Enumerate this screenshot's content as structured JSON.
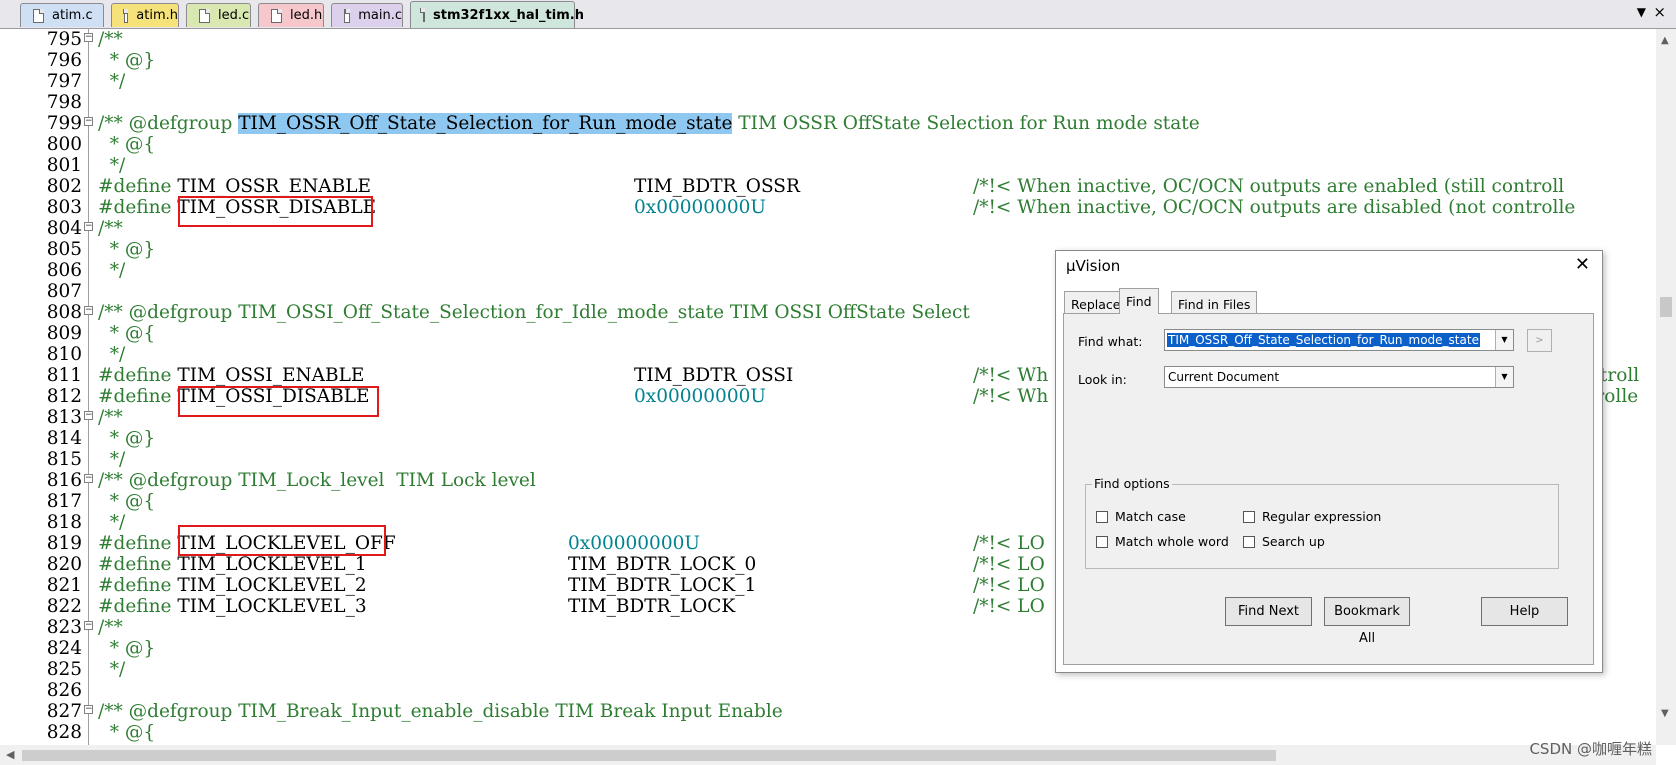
{
  "tabs": [
    {
      "label": "atim.c",
      "color": "#cfe0f5"
    },
    {
      "label": "atim.h",
      "color": "#f6e27a"
    },
    {
      "label": "led.c",
      "color": "#d8e8b0"
    },
    {
      "label": "led.h",
      "color": "#f6c8cc"
    },
    {
      "label": "main.c",
      "color": "#ddd0ec"
    },
    {
      "label": "stm32f1xx_hal_tim.h",
      "color": "#cfe6dc",
      "active": true
    }
  ],
  "tab_controls": {
    "menu": "▼",
    "close": "×"
  },
  "colors": {
    "keyword": "#2e7d32",
    "hex_literal": "#00838f",
    "selection": "#8ec8f0",
    "annotation_box": "#e0191b"
  },
  "code_lines": [
    {
      "num": "795",
      "fold": "⊟",
      "code": [
        [
          "g",
          "/**"
        ]
      ]
    },
    {
      "num": "796",
      "code": [
        [
          "g",
          "  * @}"
        ]
      ]
    },
    {
      "num": "797",
      "code": [
        [
          "g",
          "  */"
        ]
      ]
    },
    {
      "num": "798",
      "code": []
    },
    {
      "num": "799",
      "fold": "⊟",
      "code": [
        [
          "g",
          "/** @defgroup "
        ],
        [
          "sel",
          "TIM_OSSR_Off_State_Selection_for_Run_mode_state"
        ],
        [
          "g",
          " TIM OSSR OffState Selection for Run mode state"
        ]
      ]
    },
    {
      "num": "800",
      "code": [
        [
          "g",
          "  * @{"
        ]
      ]
    },
    {
      "num": "801",
      "code": [
        [
          "g",
          "  */"
        ]
      ]
    },
    {
      "num": "802",
      "code": [
        [
          "k",
          "#define "
        ],
        [
          "n",
          "TIM_OSSR_ENABLE"
        ]
      ],
      "col2": [
        [
          "n",
          "TIM_BDTR_OSSR"
        ]
      ],
      "col3": [
        [
          "g",
          "/*!< When inactive, OC/OCN outputs are enabled (still controll"
        ]
      ]
    },
    {
      "num": "803",
      "code": [
        [
          "k",
          "#define "
        ],
        [
          "n",
          "TIM_OSSR_DISABLE"
        ]
      ],
      "col2": [
        [
          "h",
          "0x00000000U"
        ]
      ],
      "col3": [
        [
          "g",
          "/*!< When inactive, OC/OCN outputs are disabled (not controlle"
        ]
      ]
    },
    {
      "num": "804",
      "fold": "⊟",
      "code": [
        [
          "g",
          "/**"
        ]
      ]
    },
    {
      "num": "805",
      "code": [
        [
          "g",
          "  * @}"
        ]
      ]
    },
    {
      "num": "806",
      "code": [
        [
          "g",
          "  */"
        ]
      ]
    },
    {
      "num": "807",
      "code": []
    },
    {
      "num": "808",
      "fold": "⊟",
      "code": [
        [
          "g",
          "/** @defgroup TIM_OSSI_Off_State_Selection_for_Idle_mode_state TIM OSSI OffState Select"
        ]
      ]
    },
    {
      "num": "809",
      "code": [
        [
          "g",
          "  * @{"
        ]
      ]
    },
    {
      "num": "810",
      "code": [
        [
          "g",
          "  */"
        ]
      ]
    },
    {
      "num": "811",
      "code": [
        [
          "k",
          "#define "
        ],
        [
          "n",
          "TIM_OSSI_ENABLE"
        ]
      ],
      "col2": [
        [
          "n",
          "TIM_BDTR_OSSI"
        ]
      ],
      "col3": [
        [
          "g",
          "/*!< Wh"
        ]
      ],
      "tail": "ntroll"
    },
    {
      "num": "812",
      "code": [
        [
          "k",
          "#define "
        ],
        [
          "n",
          "TIM_OSSI_DISABLE"
        ]
      ],
      "col2": [
        [
          "h",
          "0x00000000U"
        ]
      ],
      "col3": [
        [
          "g",
          "/*!< Wh"
        ]
      ],
      "tail": "trolle"
    },
    {
      "num": "813",
      "fold": "⊟",
      "code": [
        [
          "g",
          "/**"
        ]
      ]
    },
    {
      "num": "814",
      "code": [
        [
          "g",
          "  * @}"
        ]
      ]
    },
    {
      "num": "815",
      "code": [
        [
          "g",
          "  */"
        ]
      ]
    },
    {
      "num": "816",
      "fold": "⊟",
      "code": [
        [
          "g",
          "/** @defgroup TIM_Lock_level  TIM Lock level"
        ]
      ]
    },
    {
      "num": "817",
      "code": [
        [
          "g",
          "  * @{"
        ]
      ]
    },
    {
      "num": "818",
      "code": [
        [
          "g",
          "  */"
        ]
      ]
    },
    {
      "num": "819",
      "code": [
        [
          "k",
          "#define "
        ],
        [
          "n",
          "TIM_LOCKLEVEL_OFF"
        ]
      ],
      "col2b": [
        [
          "h",
          "0x00000000U"
        ]
      ],
      "col3": [
        [
          "g",
          "/*!< LO"
        ]
      ]
    },
    {
      "num": "820",
      "code": [
        [
          "k",
          "#define "
        ],
        [
          "n",
          "TIM_LOCKLEVEL_1"
        ]
      ],
      "col2b": [
        [
          "n",
          "TIM_BDTR_LOCK_0"
        ]
      ],
      "col3": [
        [
          "g",
          "/*!< LO"
        ]
      ]
    },
    {
      "num": "821",
      "code": [
        [
          "k",
          "#define "
        ],
        [
          "n",
          "TIM_LOCKLEVEL_2"
        ]
      ],
      "col2b": [
        [
          "n",
          "TIM_BDTR_LOCK_1"
        ]
      ],
      "col3": [
        [
          "g",
          "/*!< LO"
        ]
      ]
    },
    {
      "num": "822",
      "code": [
        [
          "k",
          "#define "
        ],
        [
          "n",
          "TIM_LOCKLEVEL_3"
        ]
      ],
      "col2b": [
        [
          "n",
          "TIM_BDTR_LOCK"
        ]
      ],
      "col3": [
        [
          "g",
          "/*!< LO"
        ]
      ]
    },
    {
      "num": "823",
      "fold": "⊟",
      "code": [
        [
          "g",
          "/**"
        ]
      ]
    },
    {
      "num": "824",
      "code": [
        [
          "g",
          "  * @}"
        ]
      ]
    },
    {
      "num": "825",
      "code": [
        [
          "g",
          "  */"
        ]
      ]
    },
    {
      "num": "826",
      "code": []
    },
    {
      "num": "827",
      "fold": "⊟",
      "code": [
        [
          "g",
          "/** @defgroup TIM_Break_Input_enable_disable TIM Break Input Enable"
        ]
      ]
    },
    {
      "num": "828",
      "code": [
        [
          "g",
          "  * @{"
        ]
      ]
    }
  ],
  "dialog": {
    "title": "µVision",
    "close": "✕",
    "tabs": [
      "Replace",
      "Find",
      "Find in Files"
    ],
    "active_tab": "Find",
    "find_what_label": "Find what:",
    "find_what_value": "TIM_OSSR_Off_State_Selection_for_Run_mode_state",
    "look_in_label": "Look in:",
    "look_in_value": "Current Document",
    "arrow_button": ">",
    "find_options_label": "Find options",
    "options": {
      "match_case": "Match case",
      "match_whole_word": "Match whole word",
      "regular_expression": "Regular expression",
      "search_up": "Search up"
    },
    "buttons": {
      "find_next": "Find Next",
      "bookmark_all": "Bookmark All",
      "help": "Help"
    }
  },
  "watermark": "CSDN @咖喱年糕"
}
